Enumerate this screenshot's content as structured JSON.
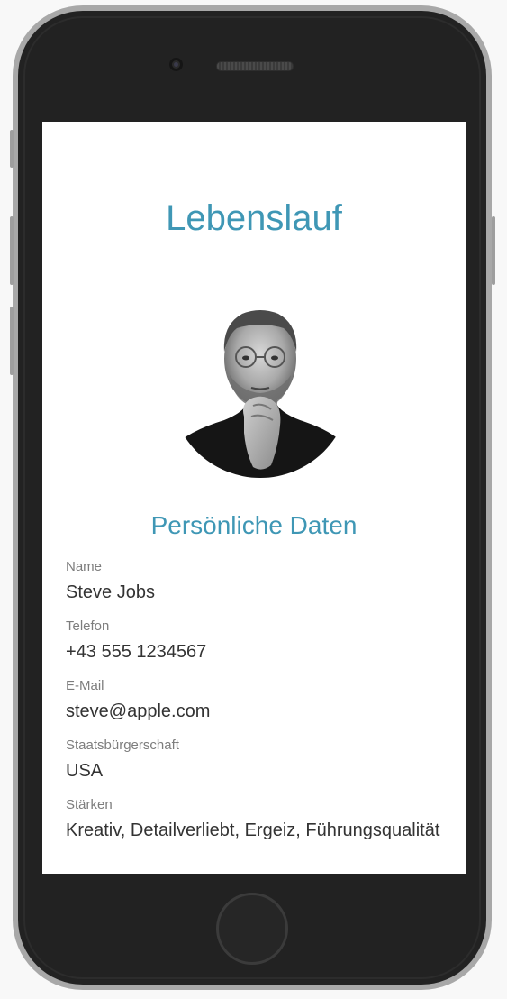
{
  "page": {
    "title": "Lebenslauf"
  },
  "profile": {
    "photo_icon": "portrait-photo",
    "section_title": "Persönliche Daten",
    "fields": [
      {
        "label": "Name",
        "value": "Steve Jobs"
      },
      {
        "label": "Telefon",
        "value": "+43 555 1234567"
      },
      {
        "label": "E-Mail",
        "value": "steve@apple.com"
      },
      {
        "label": "Staatsbürgerschaft",
        "value": "USA"
      },
      {
        "label": "Stärken",
        "value": "Kreativ, Detailverliebt, Ergeiz, Führungsqualität"
      }
    ]
  },
  "colors": {
    "accent": "#3f97b5",
    "label": "#7d7d7d",
    "value": "#333333",
    "device_body": "#222222",
    "device_frame": "#a8a8a8"
  }
}
